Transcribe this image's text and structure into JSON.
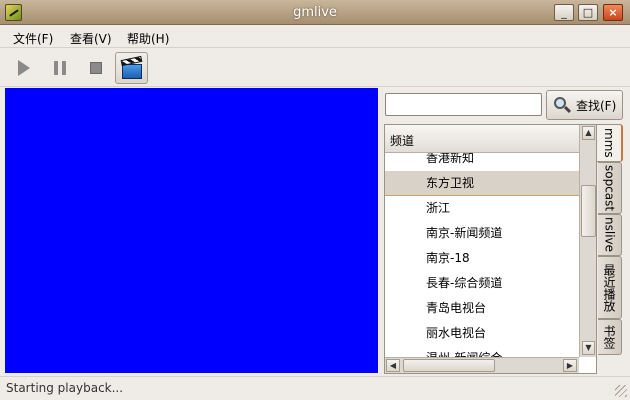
{
  "window": {
    "title": "gmlive",
    "min_glyph": "_",
    "max_glyph": "□",
    "close_glyph": "×"
  },
  "menu": {
    "items": [
      "文件(F)",
      "查看(V)",
      "帮助(H)"
    ]
  },
  "toolbar": {
    "buttons": [
      "play-icon",
      "pause-icon",
      "stop-icon",
      "clapperboard-icon"
    ]
  },
  "search": {
    "value": "",
    "button_label": "查找(F)"
  },
  "channel_list": {
    "header": "频道",
    "items": [
      "香港新知",
      "东方卫视",
      "浙江",
      "南京-新闻频道",
      "南京-18",
      "長春-综合频道",
      "青岛电视台",
      "丽水电视台",
      "温州-新闻综合"
    ],
    "selected_index": 1
  },
  "tabs": [
    "mms",
    "sopcast",
    "nslive",
    "最近播放",
    "书签"
  ],
  "status": {
    "text": "Starting playback..."
  },
  "colors": {
    "video_bg": "#0000ff",
    "selection_bg": "#d9d2c8",
    "active_tab_accent": "#c8783c"
  }
}
